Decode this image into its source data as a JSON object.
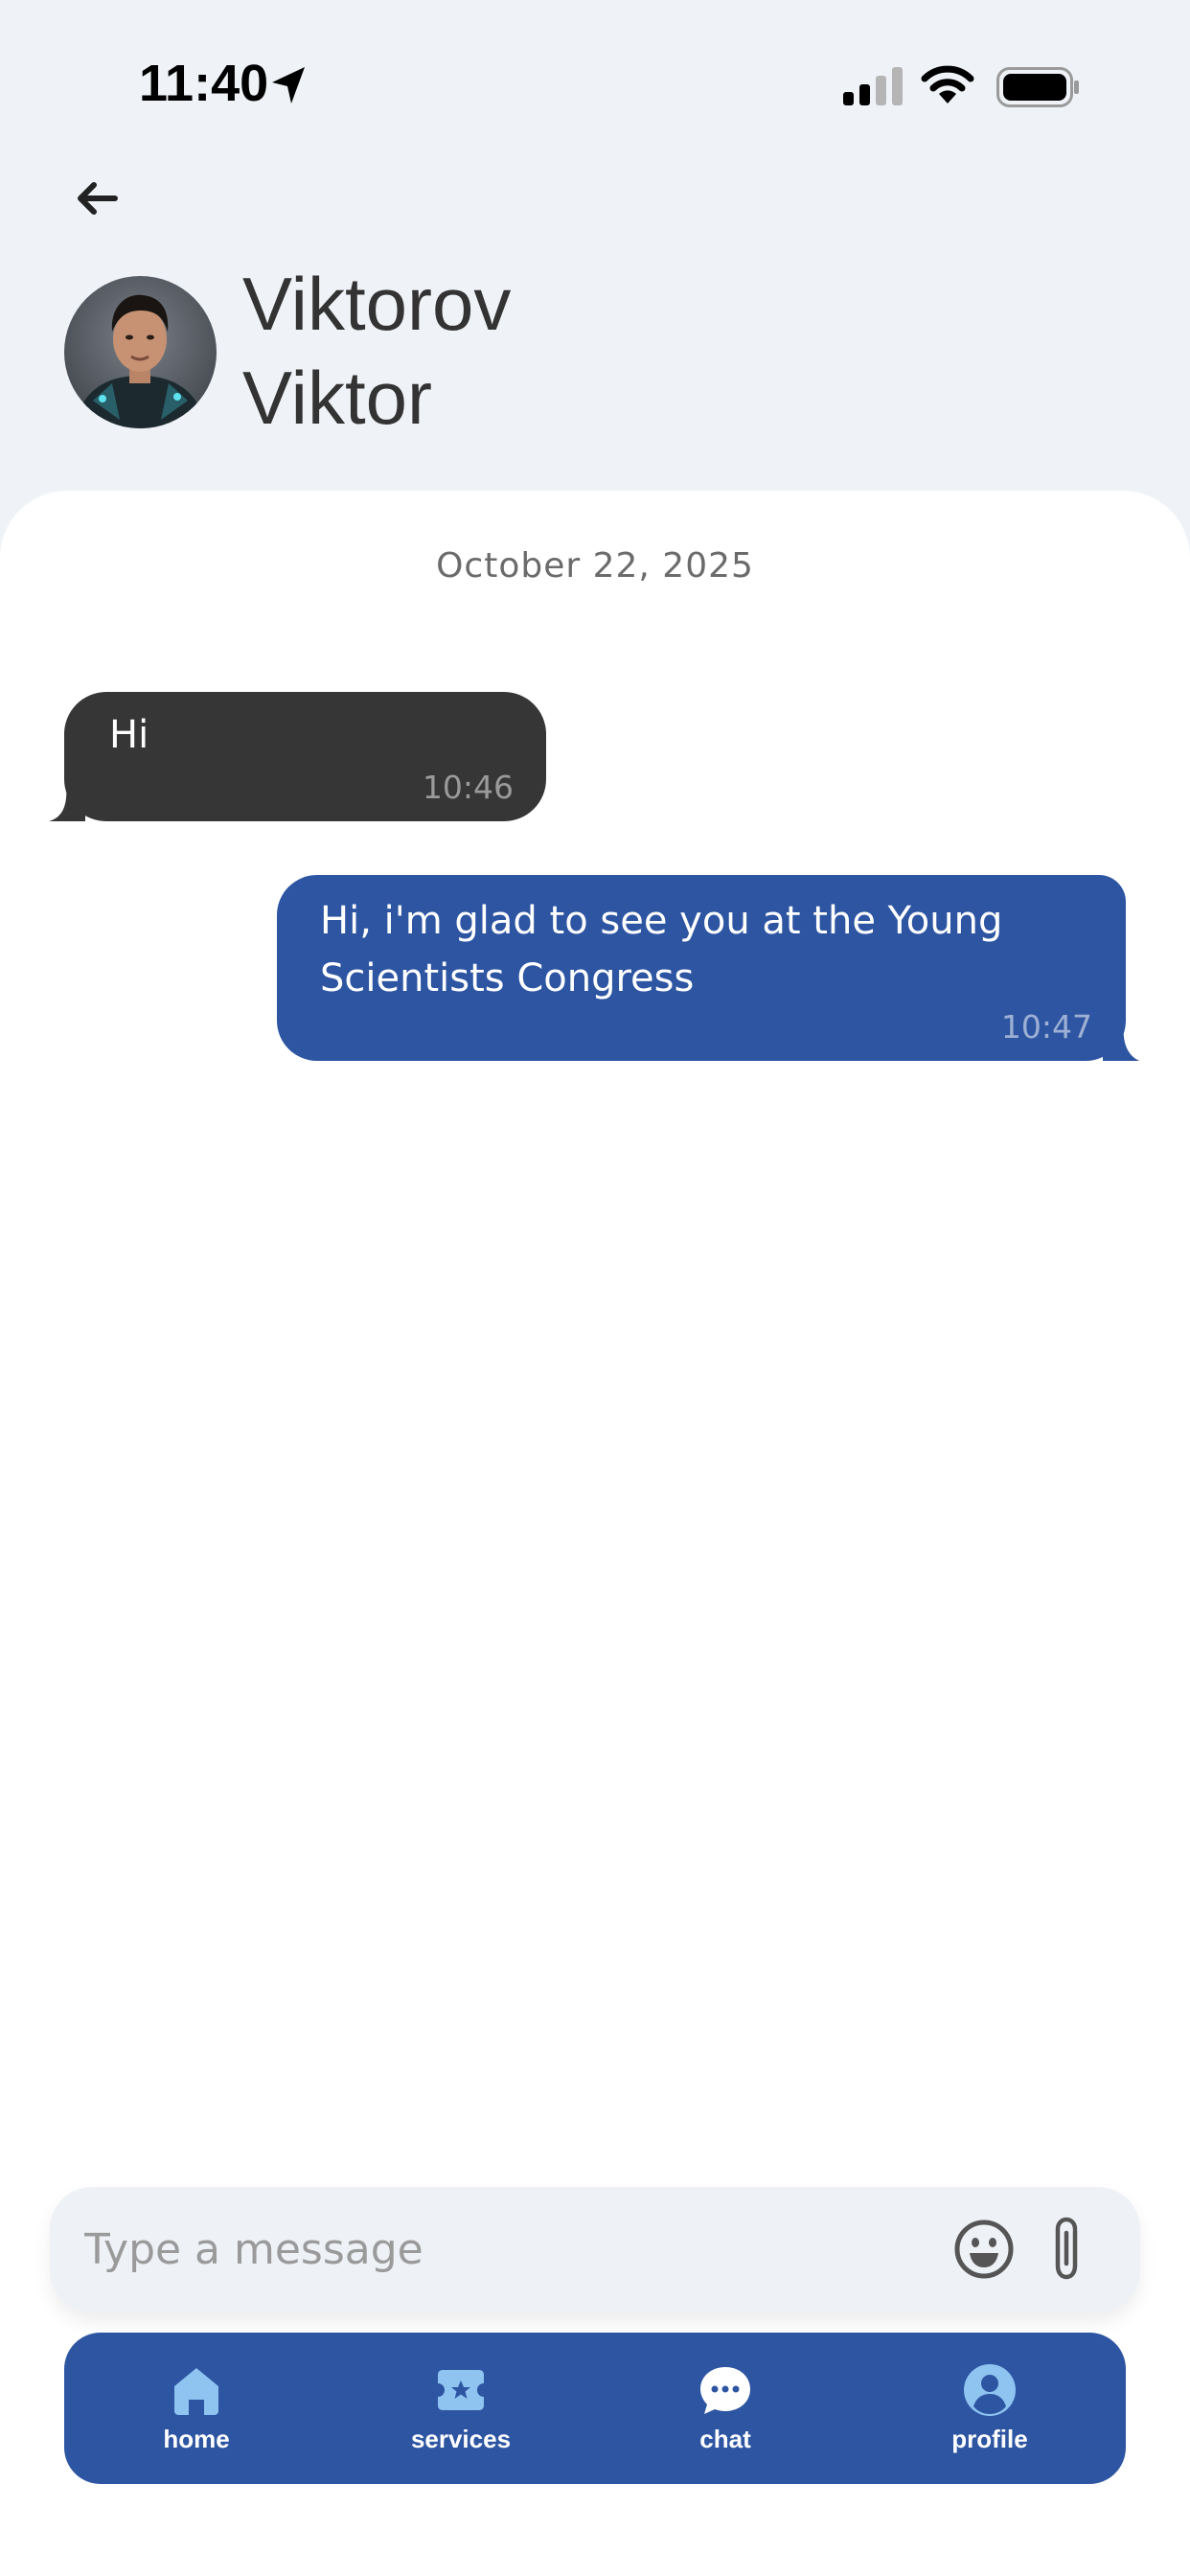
{
  "status_bar": {
    "time": "11:40"
  },
  "header": {
    "contact_last_name": "Viktorov",
    "contact_first_name": "Viktor"
  },
  "chat": {
    "date": "October 22, 2025",
    "messages": [
      {
        "direction": "incoming",
        "text": "Hi",
        "time": "10:46"
      },
      {
        "direction": "outgoing",
        "text": "Hi, i'm glad to see you at the Young Scientists Congress",
        "time": "10:47"
      }
    ]
  },
  "composer": {
    "placeholder": "Type a message"
  },
  "tabbar": {
    "items": [
      {
        "label": "home",
        "icon": "home-icon"
      },
      {
        "label": "services",
        "icon": "ticket-star-icon"
      },
      {
        "label": "chat",
        "icon": "chat-bubble-icon"
      },
      {
        "label": "profile",
        "icon": "user-circle-icon"
      }
    ]
  },
  "colors": {
    "accent": "#2d55a2",
    "incoming_bubble": "#363636",
    "background": "#eff3f7",
    "tab_icon": "#8fc3f0"
  }
}
